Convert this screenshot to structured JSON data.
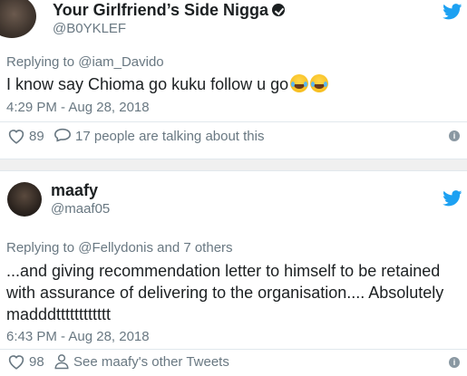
{
  "tweets": [
    {
      "display_name": "Your Girlfriend’s Side Nigga",
      "handle": "@B0YKLEF",
      "replying_to": "Replying to @iam_Davido",
      "text": "I know say Chioma go kuku follow u go",
      "emojis": [
        "face-with-tears-of-joy",
        "face-with-tears-of-joy"
      ],
      "timestamp": "4:29 PM - Aug 28, 2018",
      "likes": "89",
      "conversation": "17 people are talking about this"
    },
    {
      "display_name": "maafy",
      "handle": "@maaf05",
      "replying_to": "Replying to @Fellydonis and 7 others",
      "text": "...and giving recommendation letter to himself to be retained with assurance of delivering to the organisation.... Absolutely madddtttttttttttt",
      "timestamp": "6:43 PM - Aug 28, 2018",
      "likes": "98",
      "profile_link": "See maafy's other Tweets"
    }
  ],
  "colors": {
    "twitter_blue": "#1da1f2",
    "secondary_text": "#697882",
    "primary_text": "#1c2022"
  },
  "icons": [
    "twitter-bird-icon",
    "heart-icon",
    "reply-bubble-icon",
    "person-icon",
    "info-icon",
    "verified-badge-icon"
  ]
}
